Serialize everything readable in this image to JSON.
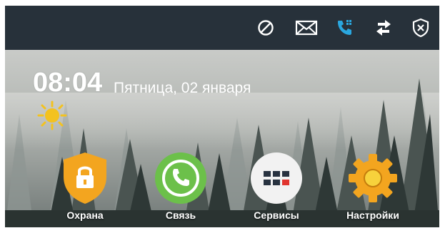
{
  "status_bar": {
    "icons": [
      "do-not-disturb-icon",
      "mail-icon",
      "call-forward-icon",
      "transfer-arrows-icon",
      "shield-disarmed-icon"
    ],
    "active_color": "#2aa7df",
    "icon_color": "#ffffff"
  },
  "home": {
    "time": "08:04",
    "date": "Пятница, 02 января",
    "weather_icon": "sun-icon"
  },
  "apps": [
    {
      "label": "Охрана",
      "icon": "security-lock-icon",
      "color": "#f3a51f"
    },
    {
      "label": "Связь",
      "icon": "phone-icon",
      "color": "#6cc04a"
    },
    {
      "label": "Сервисы",
      "icon": "services-grid-icon",
      "color": "#f2f2f2"
    },
    {
      "label": "Настройки",
      "icon": "settings-gear-icon",
      "color": "#f3a51f"
    }
  ],
  "colors": {
    "topbar": "#27313a",
    "accent_orange": "#f3a51f",
    "accent_green": "#6cc04a",
    "accent_red": "#e0342f"
  }
}
